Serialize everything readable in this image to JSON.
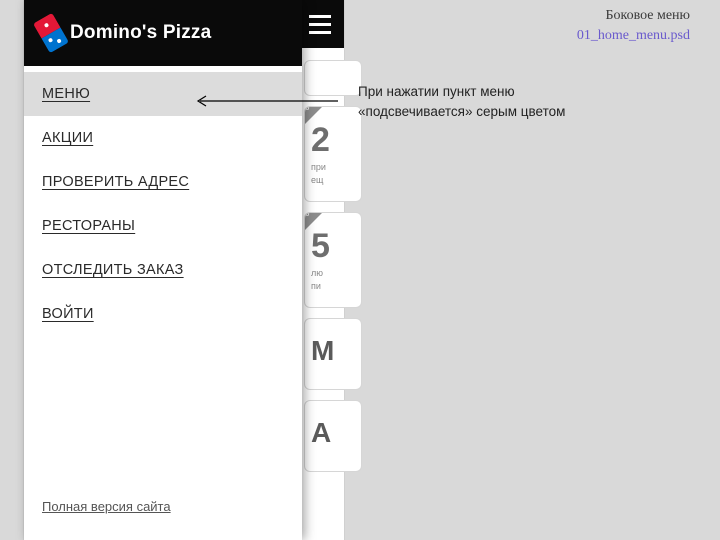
{
  "page_label": {
    "title": "Боковое меню",
    "file": "01_home_menu.psd"
  },
  "brand": "Domino's Pizza",
  "sidebar": {
    "items": [
      {
        "label": "МЕНЮ"
      },
      {
        "label": "АКЦИИ"
      },
      {
        "label": "ПРОВЕРИТЬ АДРЕС"
      },
      {
        "label": "РЕСТОРАНЫ"
      },
      {
        "label": "ОТСЛЕДИТЬ ЗАКАЗ"
      },
      {
        "label": "ВОЙТИ"
      }
    ],
    "footer": "Полная версия сайта"
  },
  "cards": {
    "promo1": {
      "num": "2",
      "line1": "при",
      "line2": "ещ"
    },
    "promo2": {
      "num": "5",
      "line1": "лю",
      "line2": "пи"
    },
    "tile1": "M",
    "tile2": "А"
  },
  "annotation": "При нажатии пункт меню «подсвечивается» серым цветом"
}
